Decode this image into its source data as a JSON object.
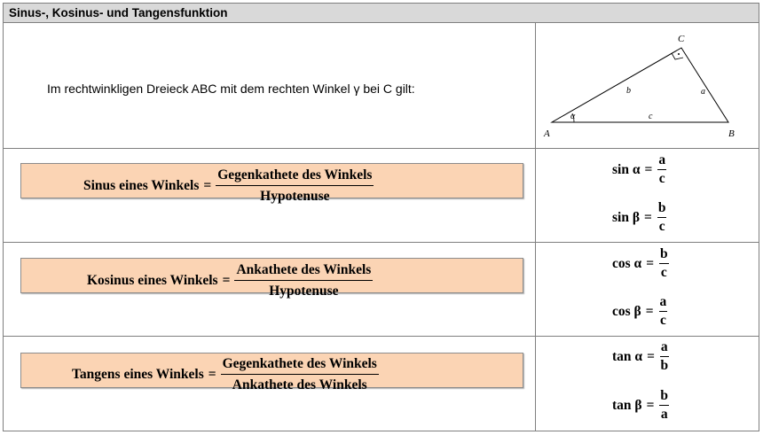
{
  "title": "Sinus-, Kosinus- und Tangensfunktion",
  "intro": "Im rechtwinkligen Dreieck ABC mit dem rechten Winkel γ bei C gilt:",
  "triangle": {
    "vertex_a": "A",
    "vertex_b": "B",
    "vertex_c": "C",
    "side_a": "a",
    "side_b": "b",
    "side_c": "c",
    "angle_alpha": "α"
  },
  "rows": [
    {
      "label": "Sinus eines Winkels",
      "numerator": "Gegenkathete des Winkels",
      "denominator": "Hypotenuse",
      "examples": [
        {
          "lhs": "sin α",
          "num": "a",
          "den": "c"
        },
        {
          "lhs": "sin β",
          "num": "b",
          "den": "c"
        }
      ]
    },
    {
      "label": "Kosinus eines Winkels",
      "numerator": "Ankathete des Winkels",
      "denominator": "Hypotenuse",
      "examples": [
        {
          "lhs": "cos α",
          "num": "b",
          "den": "c"
        },
        {
          "lhs": "cos β",
          "num": "a",
          "den": "c"
        }
      ]
    },
    {
      "label": "Tangens eines Winkels",
      "numerator": "Gegenkathete des Winkels",
      "denominator": "Ankathete des Winkels",
      "examples": [
        {
          "lhs": "tan α",
          "num": "a",
          "den": "b"
        },
        {
          "lhs": "tan β",
          "num": "b",
          "den": "a"
        }
      ]
    }
  ],
  "equals": "="
}
